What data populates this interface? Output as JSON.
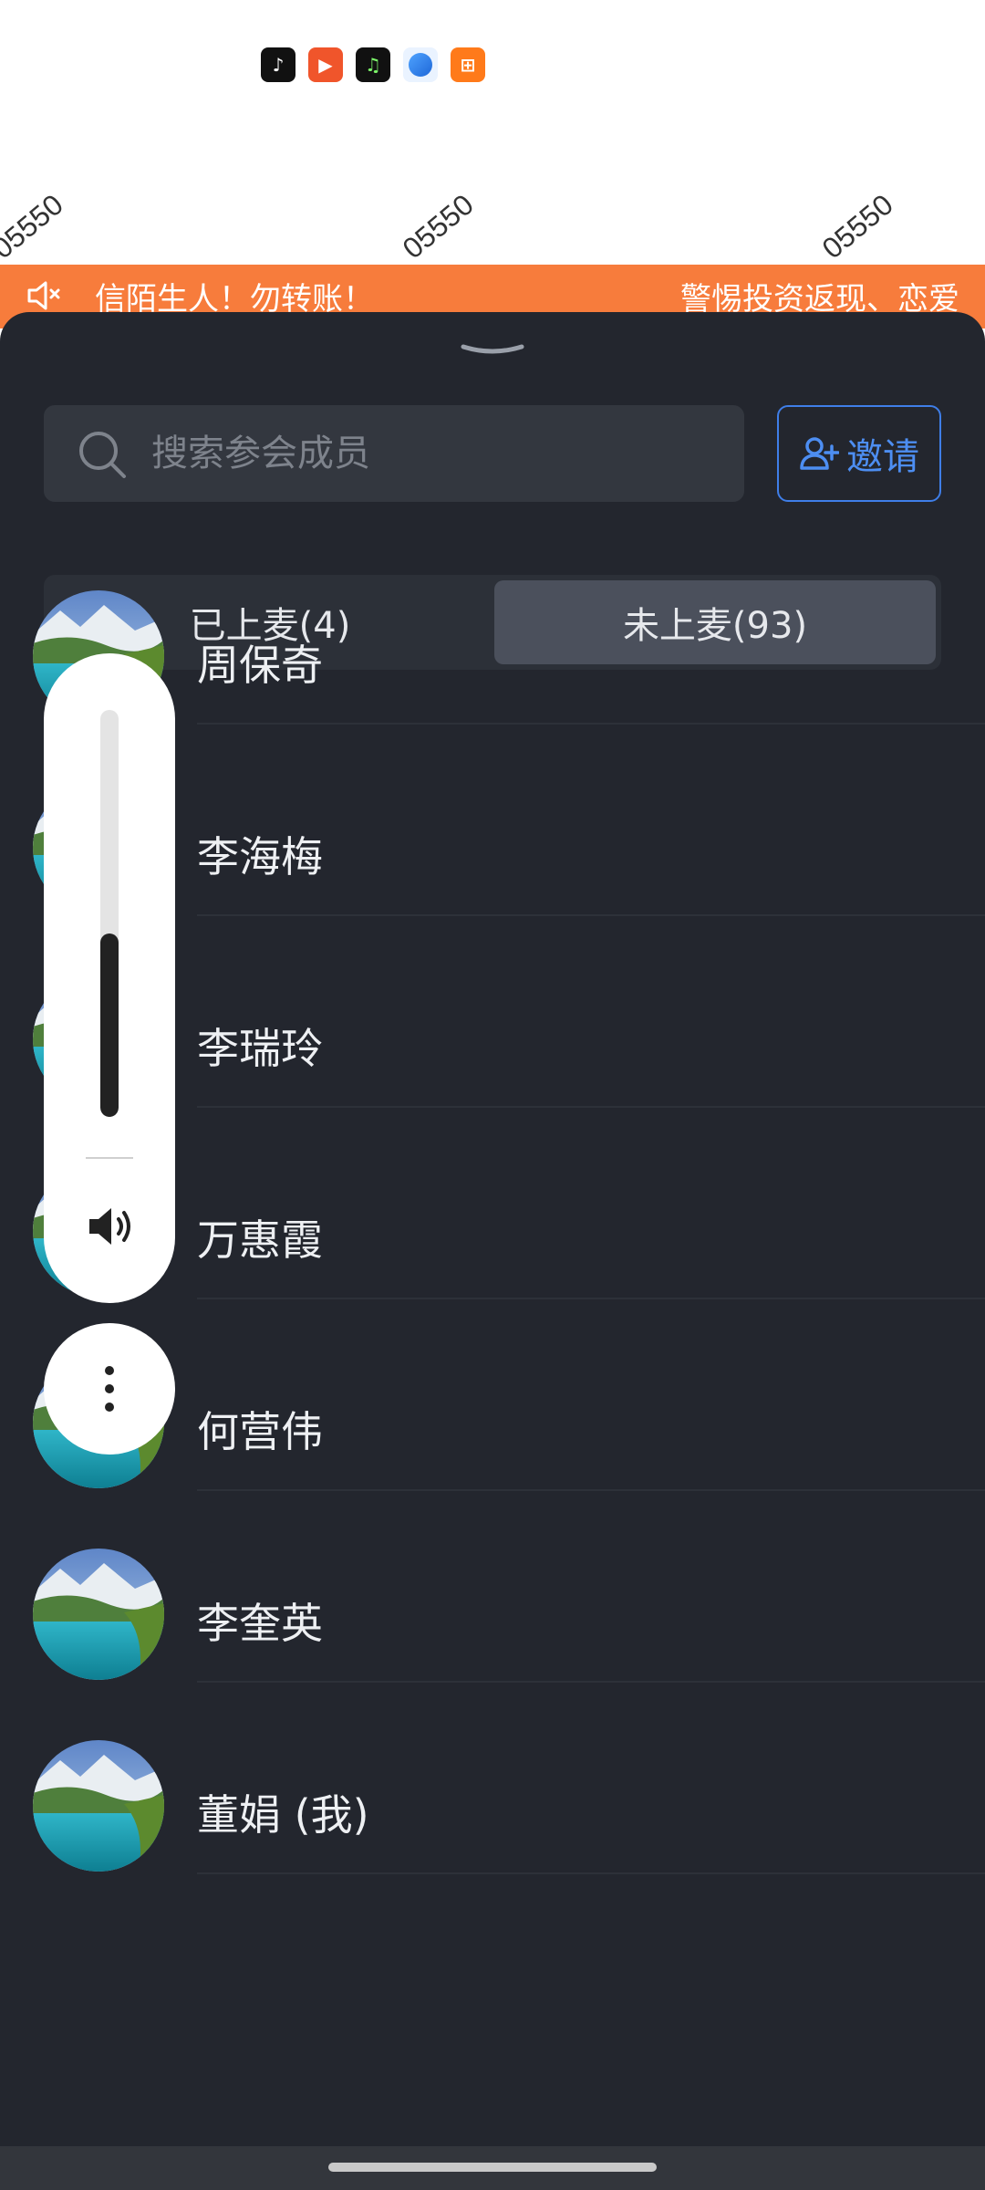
{
  "status_icons": [
    {
      "name": "tiktok-app-icon",
      "glyph": "♪"
    },
    {
      "name": "video-app-icon",
      "glyph": "▶"
    },
    {
      "name": "music-app-icon",
      "glyph": "♫"
    },
    {
      "name": "blue-app-icon",
      "glyph": ""
    },
    {
      "name": "kuai-app-icon",
      "glyph": "⊞"
    }
  ],
  "watermark": {
    "items": [
      "05550",
      "05550",
      "05550"
    ]
  },
  "notice": {
    "text_1": "信陌生人！勿转账！",
    "text_2": "警惕投资返现、恋爱"
  },
  "search": {
    "placeholder": "搜索参会成员",
    "value": ""
  },
  "invite": {
    "label": "邀请"
  },
  "tabs": {
    "on_mic": "已上麦(4)",
    "off_mic": "未上麦(93)",
    "active": "off_mic"
  },
  "members": [
    {
      "name": "周保奇"
    },
    {
      "name": "李海梅"
    },
    {
      "name": "李瑞玲"
    },
    {
      "name": "万惠霞"
    },
    {
      "name": "何营伟"
    },
    {
      "name": "李奎英"
    },
    {
      "name": "董娟 (我)"
    }
  ],
  "volume": {
    "level": 0.45
  },
  "colors": {
    "sheet_bg": "#23262e",
    "accent_blue": "#4d8ef2",
    "notice_orange": "#f77c3c"
  }
}
